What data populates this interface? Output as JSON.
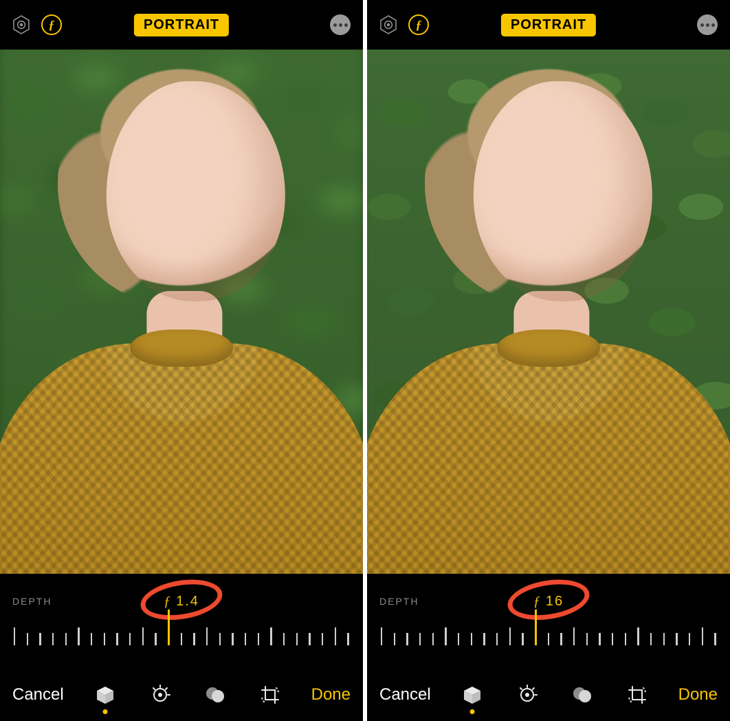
{
  "panels": [
    {
      "mode_label": "PORTRAIT",
      "depth_label": "DEPTH",
      "aperture_prefix": "ƒ",
      "aperture_value": "1.4",
      "slider_position_pct": 46,
      "background_blur": true,
      "cancel_label": "Cancel",
      "done_label": "Done",
      "tick_count": 27,
      "marker_annotated": true
    },
    {
      "mode_label": "PORTRAIT",
      "depth_label": "DEPTH",
      "aperture_prefix": "ƒ",
      "aperture_value": "16",
      "slider_position_pct": 46,
      "background_blur": false,
      "cancel_label": "Cancel",
      "done_label": "Done",
      "tick_count": 27,
      "marker_annotated": true
    }
  ],
  "colors": {
    "accent": "#f7c600",
    "annotate": "#ed4a2f"
  },
  "icons": {
    "live_photo": "hexagon-icon",
    "aperture_badge": "f-stop-icon",
    "more": "more-icon",
    "portrait_tool": "cube-icon",
    "adjust_tool": "adjust-dial-icon",
    "filters_tool": "filters-icon",
    "crop_tool": "crop-rotate-icon"
  }
}
